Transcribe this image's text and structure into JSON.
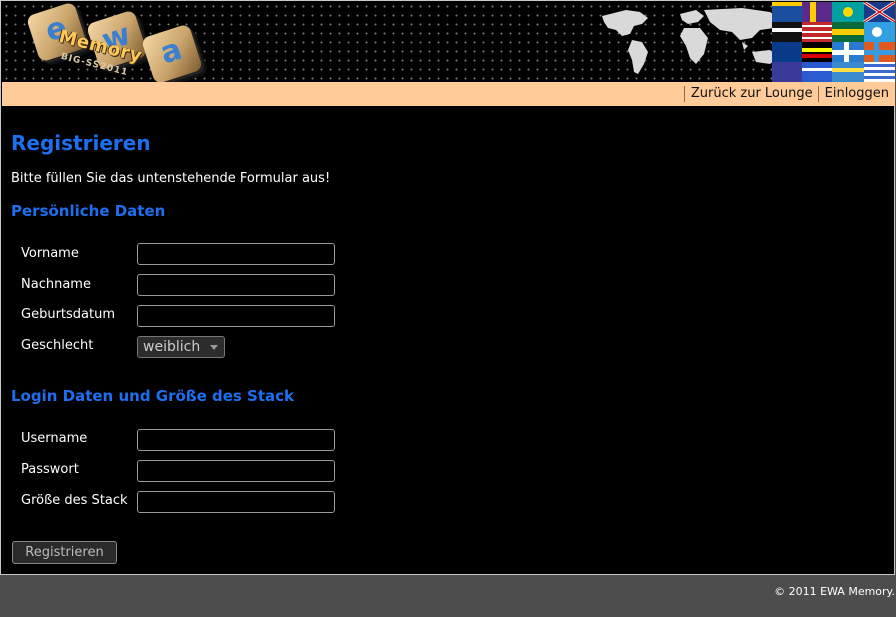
{
  "logo": {
    "tiles": [
      "e",
      "w",
      "a"
    ],
    "word": "Memory",
    "subtitle": "BIG-SS2011"
  },
  "nav": {
    "links": [
      "Zurück zur Lounge",
      "Einloggen"
    ]
  },
  "page": {
    "title": "Registrieren",
    "intro": "Bitte füllen Sie das untenstehende Formular aus!"
  },
  "personal": {
    "heading": "Persönliche Daten",
    "first_name_label": "Vorname",
    "last_name_label": "Nachname",
    "birthdate_label": "Geburtsdatum",
    "gender_label": "Geschlecht",
    "gender_value": "weiblich"
  },
  "login": {
    "heading": "Login Daten und Größe des Stack",
    "username_label": "Username",
    "password_label": "Passwort",
    "stack_size_label": "Größe des Stack"
  },
  "form": {
    "submit_label": "Registrieren"
  },
  "footer": {
    "text": "© 2011 EWA Memory."
  },
  "colors": {
    "heading": "#1e6ef0",
    "navbar": "#ffcc99",
    "background": "#000000",
    "footer": "#4d4d4d"
  }
}
